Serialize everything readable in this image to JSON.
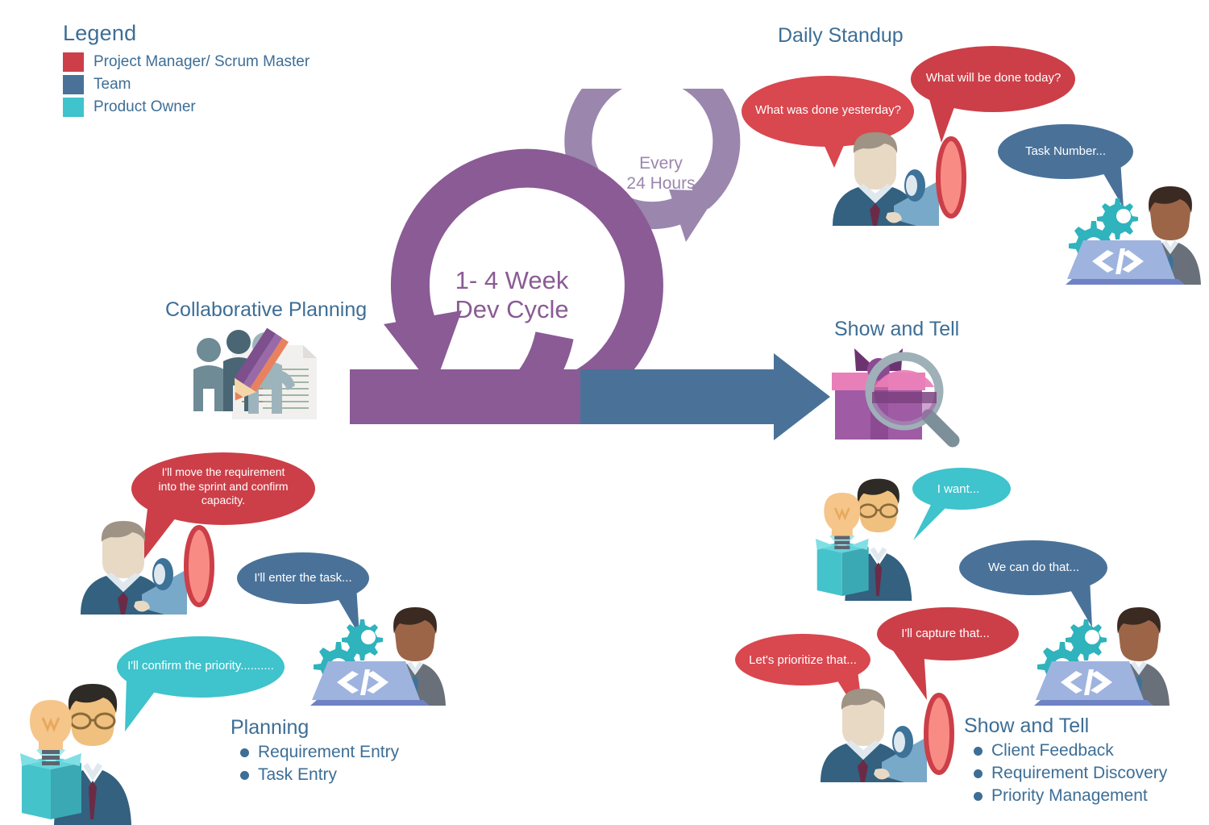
{
  "legend": {
    "title": "Legend",
    "items": [
      {
        "label": "Project Manager/ Scrum Master",
        "color": "#cc3f48"
      },
      {
        "label": "Team",
        "color": "#4a7299"
      },
      {
        "label": "Product Owner",
        "color": "#3fc3cc"
      }
    ]
  },
  "cycle": {
    "main_line1": "1- 4 Week",
    "main_line2": "Dev Cycle",
    "sub_line1": "Every",
    "sub_line2": "24 Hours",
    "main_color": "#8a5b95",
    "sub_color": "#9b86ad"
  },
  "sections": {
    "collaborative_planning": {
      "title": "Collaborative Planning"
    },
    "daily_standup": {
      "title": "Daily Standup"
    },
    "show_and_tell_top": {
      "title": "Show and Tell"
    },
    "planning": {
      "title": "Planning",
      "bullets": [
        "Requirement Entry",
        "Task Entry"
      ]
    },
    "show_and_tell_bottom": {
      "title": "Show and Tell",
      "bullets": [
        "Client Feedback",
        "Requirement Discovery",
        "Priority Management"
      ]
    }
  },
  "bubbles": {
    "standup_yesterday": {
      "text": "What was done yesterday?",
      "color": "#d9474f"
    },
    "standup_today": {
      "text": "What will be done today?",
      "color": "#cc3f48"
    },
    "standup_task": {
      "text": "Task Number...",
      "color": "#4a7299"
    },
    "planning_move": {
      "text": "I'll move the requirement into the sprint and confirm capacity.",
      "color": "#cc3f48"
    },
    "planning_enter": {
      "text": "I'll enter the task...",
      "color": "#4a7299"
    },
    "planning_priority": {
      "text": "I'll confirm the priority..........",
      "color": "#3fc3cc"
    },
    "show_want": {
      "text": "I want...",
      "color": "#3fc3cc"
    },
    "show_cando": {
      "text": "We can do that...",
      "color": "#4a7299"
    },
    "show_capture": {
      "text": "I'll capture that...",
      "color": "#cc3f48"
    },
    "show_prioritize": {
      "text": "Let's prioritize that...",
      "color": "#d9474f"
    }
  },
  "icons": {
    "collaborative_planning": "people-document-pencil-icon",
    "show_and_tell": "gift-magnifier-icon",
    "megaphone_person": "megaphone-person-icon",
    "developer": "developer-laptop-icon",
    "product_owner": "lightbulb-box-person-icon"
  },
  "arrows": {
    "dev_cycle_color": "#8a5b95",
    "daily_cycle_color": "#9b86ad",
    "sprint_arrow_left_color": "#8a5b95",
    "sprint_arrow_right_color": "#4a7299"
  }
}
